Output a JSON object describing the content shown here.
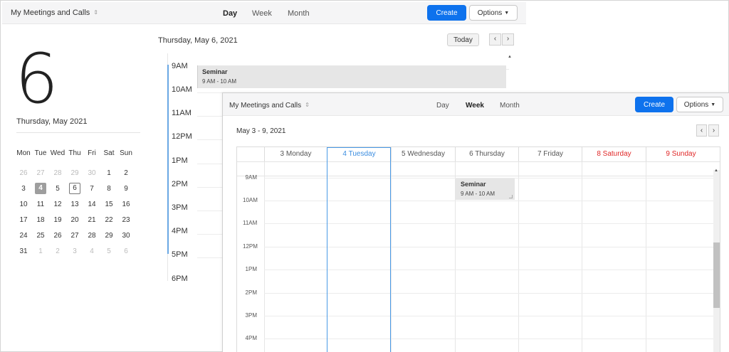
{
  "day_window": {
    "title": "My Meetings and Calls",
    "tabs": [
      {
        "label": "Day"
      },
      {
        "label": "Week"
      },
      {
        "label": "Month"
      }
    ],
    "create_label": "Create",
    "options_label": "Options",
    "big_day": "6",
    "month_year": "Thursday, May 2021",
    "date_heading": "Thursday, May 6, 2021",
    "today_label": "Today",
    "hours": [
      "9AM",
      "10AM",
      "11AM",
      "12PM",
      "1PM",
      "2PM",
      "3PM",
      "4PM",
      "5PM",
      "6PM"
    ],
    "event": {
      "title": "Seminar",
      "time": "9 AM - 10 AM"
    }
  },
  "mini_calendar": {
    "weekdays": [
      "Mon",
      "Tue",
      "Wed",
      "Thu",
      "Fri",
      "Sat",
      "Sun"
    ],
    "weeks": [
      [
        "26",
        "27",
        "28",
        "29",
        "30",
        "1",
        "2"
      ],
      [
        "3",
        "4",
        "5",
        "6",
        "7",
        "8",
        "9"
      ],
      [
        "10",
        "11",
        "12",
        "13",
        "14",
        "15",
        "16"
      ],
      [
        "17",
        "18",
        "19",
        "20",
        "21",
        "22",
        "23"
      ],
      [
        "24",
        "25",
        "26",
        "27",
        "28",
        "29",
        "30"
      ],
      [
        "31",
        "1",
        "2",
        "3",
        "4",
        "5",
        "6"
      ]
    ]
  },
  "week_window": {
    "title": "My Meetings and Calls",
    "tabs": [
      {
        "label": "Day"
      },
      {
        "label": "Week"
      },
      {
        "label": "Month"
      }
    ],
    "create_label": "Create",
    "options_label": "Options",
    "range": "May 3 - 9, 2021",
    "days": [
      "3 Monday",
      "4 Tuesday",
      "5 Wednesday",
      "6 Thursday",
      "7 Friday",
      "8 Saturday",
      "9 Sunday"
    ],
    "hours": [
      "9AM",
      "10AM",
      "11AM",
      "12PM",
      "1PM",
      "2PM",
      "3PM",
      "4PM"
    ],
    "event": {
      "title": "Seminar",
      "time": "9 AM - 10 AM"
    }
  },
  "icons": {
    "sort": "⇕",
    "caret": "▼",
    "prev": "‹",
    "next": "›",
    "scroll_up": "▲"
  },
  "colors": {
    "primary": "#0e72ed",
    "today_blue": "#4a9ae6",
    "weekend_red": "#e02828"
  }
}
